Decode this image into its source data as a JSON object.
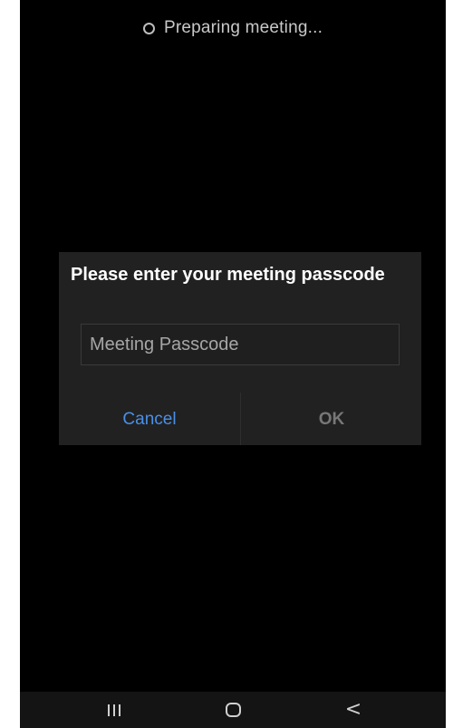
{
  "status": {
    "text": "Preparing meeting...",
    "icon": "loading-spinner-icon"
  },
  "dialog": {
    "title": "Please enter your meeting passcode",
    "input": {
      "placeholder": "Meeting Passcode",
      "value": ""
    },
    "cancel_label": "Cancel",
    "ok_label": "OK"
  },
  "navbar": {
    "recents_icon": "recents-icon",
    "home_icon": "home-icon",
    "back_icon": "back-icon",
    "back_glyph": "<"
  },
  "colors": {
    "background": "#000000",
    "dialog_background": "#212121",
    "cancel_accent": "#4a8fe6",
    "ok_disabled": "#777777"
  }
}
